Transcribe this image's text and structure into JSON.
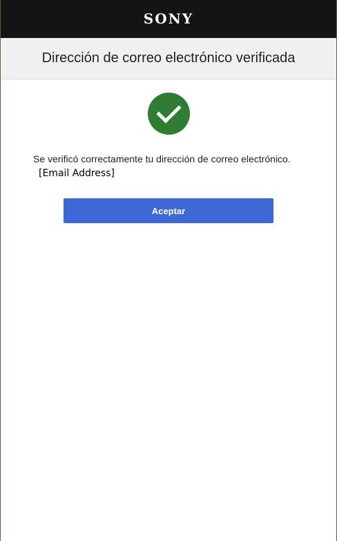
{
  "header": {
    "logo_text": "SONY"
  },
  "page": {
    "title": "Dirección de correo electrónico verificada",
    "message": "Se verificó correctamente tu dirección de correo electrónico.",
    "email": "[Email Address]"
  },
  "actions": {
    "accept_label": "Aceptar"
  },
  "icons": {
    "status": "check-circle-icon"
  },
  "colors": {
    "top_bar": "#141414",
    "title_band": "#f0f0f0",
    "success_green": "#2e7d32",
    "button_blue": "#3d68d6"
  }
}
